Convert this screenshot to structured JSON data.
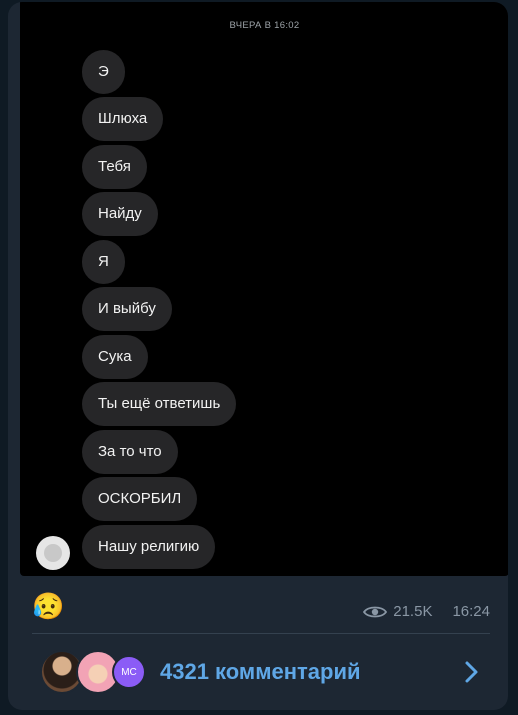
{
  "screenshot": {
    "date_separator": "ВЧЕРА В 16:02",
    "messages": [
      "Э",
      "Шлюха",
      "Тебя",
      "Найду",
      "Я",
      "И выйбу",
      "Сука",
      "Ты ещё ответишь",
      "За то что",
      "ОСКОРБИЛ",
      "Нашу религию"
    ]
  },
  "post_footer": {
    "reaction_emoji": "😥",
    "views": "21.5K",
    "time": "16:24"
  },
  "comments": {
    "label": "4321 комментарий",
    "avatar3_text": "MC"
  },
  "colors": {
    "accent": "#5fa7e6",
    "bubble": "#262628",
    "card": "#1d2733"
  }
}
